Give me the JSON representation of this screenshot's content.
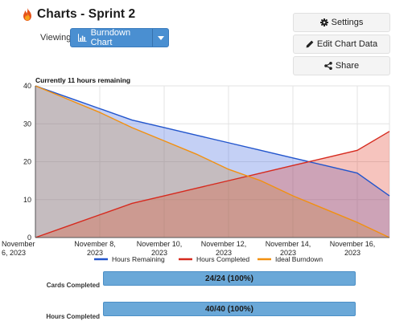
{
  "header": {
    "title": "Charts - Sprint 2",
    "viewing_label": "Viewing"
  },
  "view_select": {
    "selected": "Burndown Chart"
  },
  "actions": {
    "settings": "Settings",
    "edit": "Edit Chart Data",
    "share": "Share"
  },
  "remaining_text": "Currently 11 hours remaining",
  "colors": {
    "remaining": "#2255cc",
    "completed": "#d62a1e",
    "ideal": "#f2900f"
  },
  "chart_data": {
    "type": "area",
    "x": [
      "2023-11-06",
      "2023-11-07",
      "2023-11-08",
      "2023-11-09",
      "2023-11-10",
      "2023-11-11",
      "2023-11-12",
      "2023-11-13",
      "2023-11-14",
      "2023-11-15",
      "2023-11-16",
      "2023-11-17"
    ],
    "x_tick_labels": [
      [
        "November",
        "6, 2023"
      ],
      [
        "November 8,",
        "2023"
      ],
      [
        "November 10,",
        "2023"
      ],
      [
        "November 12,",
        "2023"
      ],
      [
        "November 14,",
        "2023"
      ],
      [
        "November 16,",
        "2023"
      ]
    ],
    "y_ticks": [
      "0",
      "10",
      "20",
      "30",
      "40"
    ],
    "ylim": [
      0,
      40
    ],
    "grid": true,
    "legend_position": "bottom",
    "series": [
      {
        "name": "Hours Remaining",
        "values": [
          40,
          37,
          34,
          31,
          29,
          27,
          25,
          23,
          21,
          19,
          17,
          11
        ]
      },
      {
        "name": "Hours Completed",
        "values": [
          0,
          3,
          6,
          9,
          11,
          13,
          15,
          17,
          19,
          21,
          23,
          28
        ]
      },
      {
        "name": "Ideal Burndown",
        "values": [
          40,
          36.5,
          33,
          29,
          25.5,
          22,
          18,
          15,
          11,
          7.5,
          4,
          0
        ]
      }
    ]
  },
  "stats": [
    {
      "label": "Cards Completed",
      "value": "24/24 (100%)",
      "fraction": 1.0
    },
    {
      "label": "Hours Completed",
      "value": "40/40 (100%)",
      "fraction": 1.0
    }
  ]
}
